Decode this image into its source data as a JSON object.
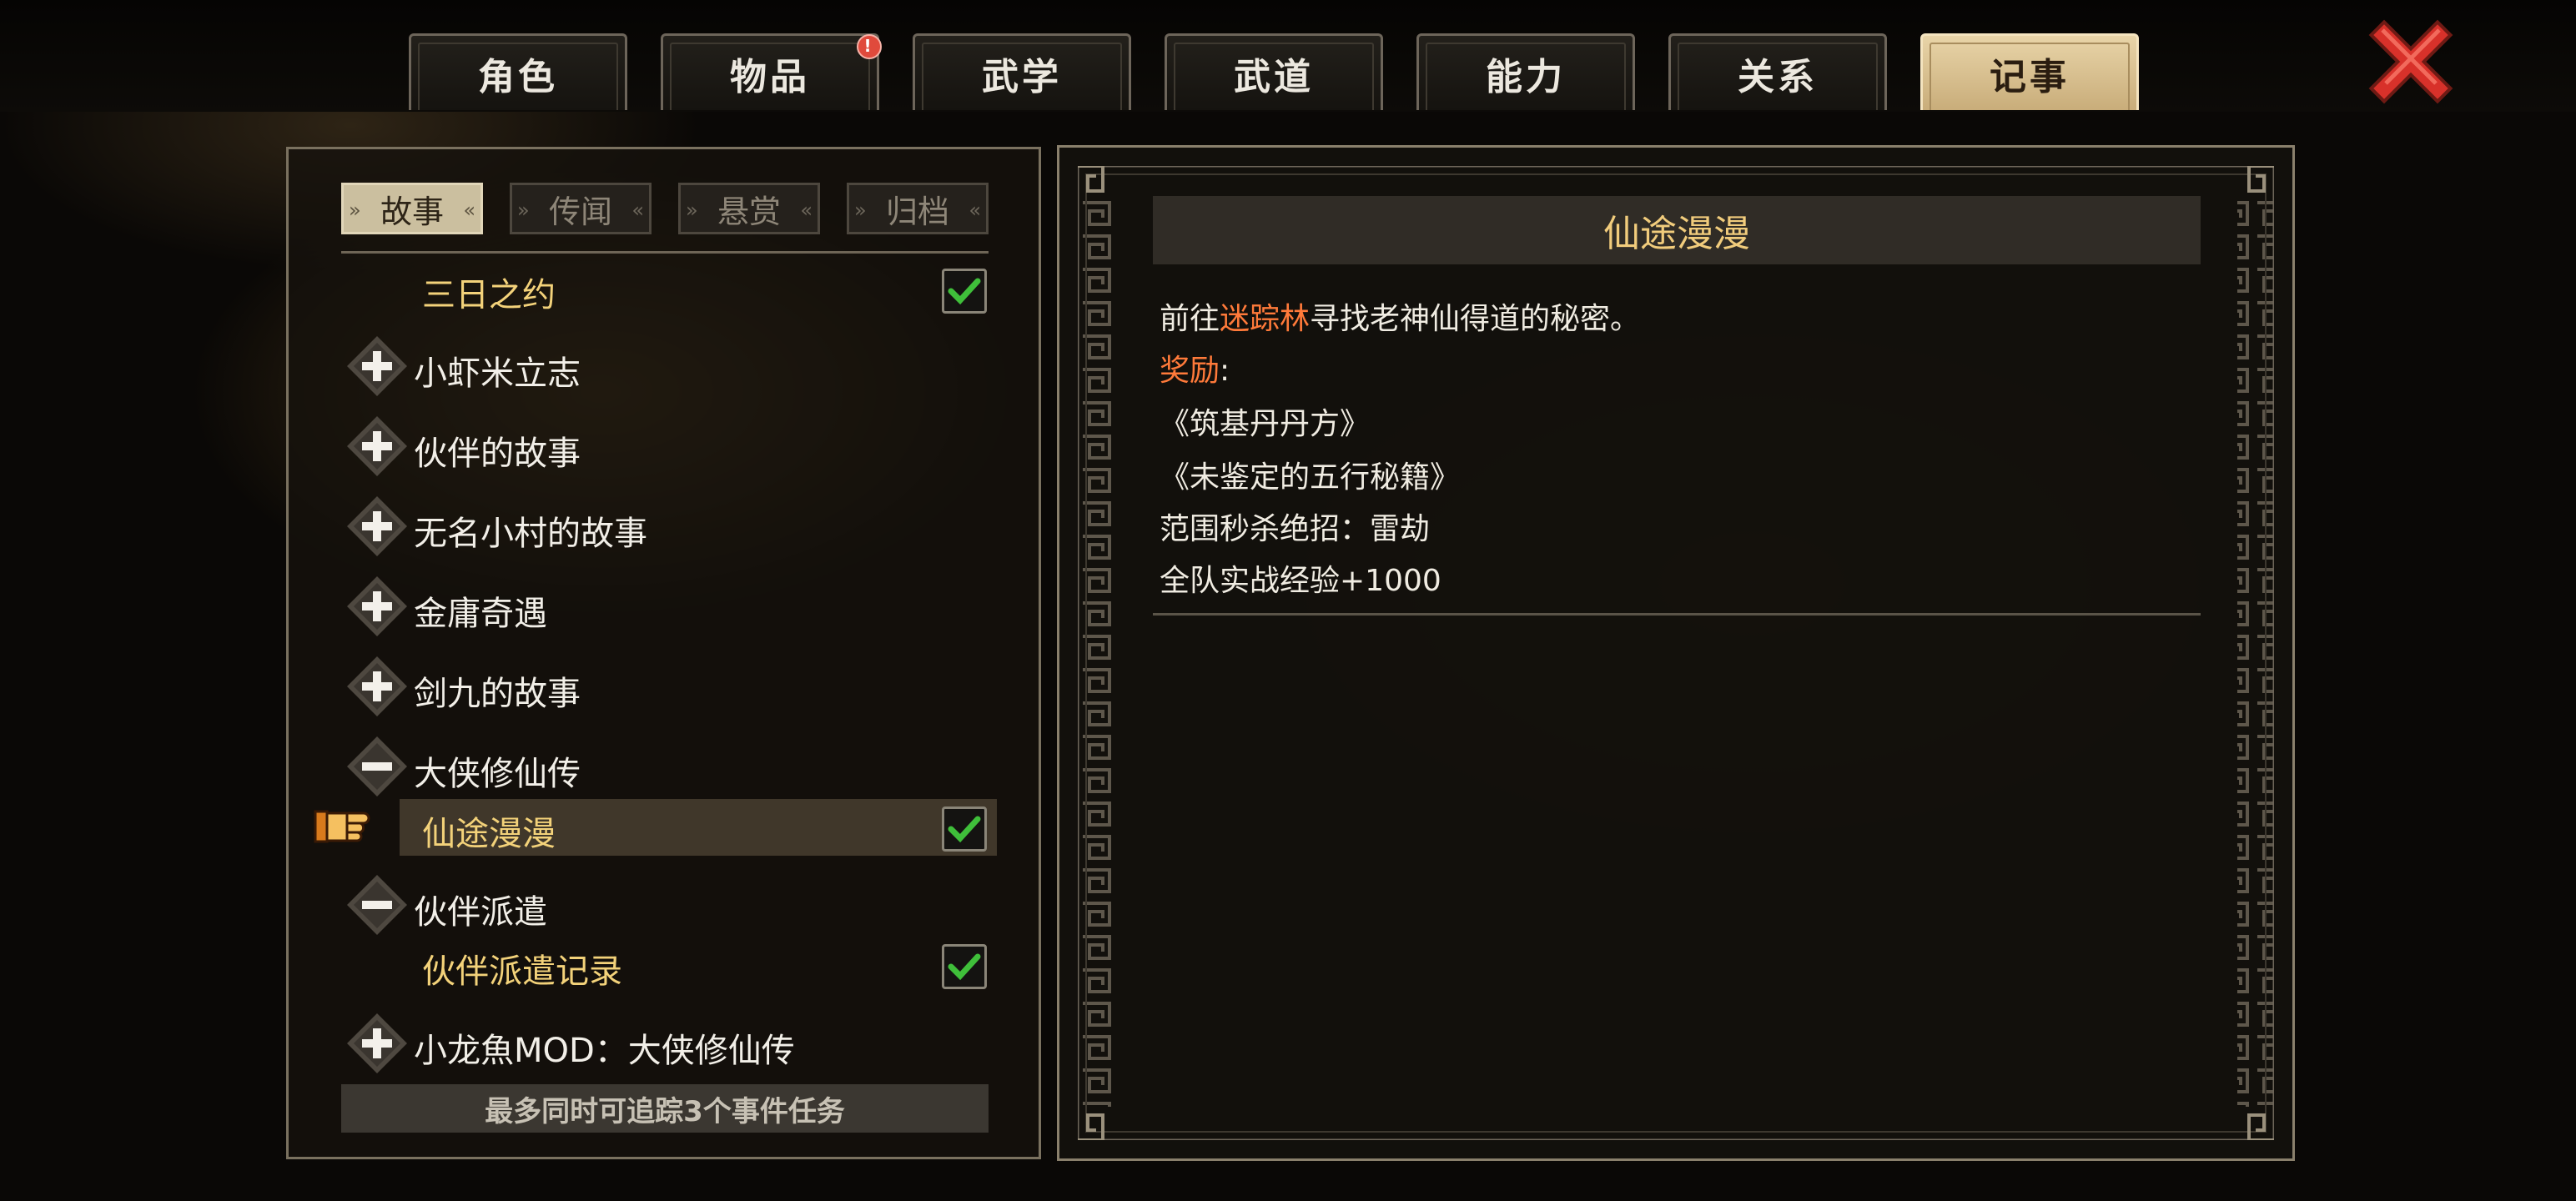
{
  "tabs": [
    {
      "label": "角色",
      "active": false,
      "badge": ""
    },
    {
      "label": "物品",
      "active": false,
      "badge": "!"
    },
    {
      "label": "武学",
      "active": false,
      "badge": ""
    },
    {
      "label": "武道",
      "active": false,
      "badge": ""
    },
    {
      "label": "能力",
      "active": false,
      "badge": ""
    },
    {
      "label": "关系",
      "active": false,
      "badge": ""
    },
    {
      "label": "记事",
      "active": true,
      "badge": ""
    }
  ],
  "subtabs": [
    {
      "label": "故事",
      "active": true
    },
    {
      "label": "传闻",
      "active": false
    },
    {
      "label": "悬赏",
      "active": false
    },
    {
      "label": "归档",
      "active": false
    }
  ],
  "list": [
    {
      "type": "quest",
      "label": "三日之约",
      "checked": true
    },
    {
      "type": "group",
      "label": "小虾米立志",
      "expanded": false
    },
    {
      "type": "group",
      "label": "伙伴的故事",
      "expanded": false
    },
    {
      "type": "group",
      "label": "无名小村的故事",
      "expanded": false
    },
    {
      "type": "group",
      "label": "金庸奇遇",
      "expanded": false
    },
    {
      "type": "group",
      "label": "剑九的故事",
      "expanded": false
    },
    {
      "type": "group",
      "label": "大侠修仙传",
      "expanded": true
    },
    {
      "type": "quest",
      "label": "仙途漫漫",
      "checked": true,
      "selected": true
    },
    {
      "type": "group",
      "label": "伙伴派遣",
      "expanded": true
    },
    {
      "type": "quest",
      "label": "伙伴派遣记录",
      "checked": true
    },
    {
      "type": "group",
      "label": "小龙魚MOD：大侠修仙传",
      "expanded": false
    }
  ],
  "footer_text": "最多同时可追踪3个事件任务",
  "detail": {
    "title": "仙途漫漫",
    "desc_prefix": "前往",
    "desc_place": "迷踪林",
    "desc_suffix": "寻找老神仙得道的秘密。",
    "reward_label": "奖励",
    "reward_colon": ":",
    "rewards": [
      "《筑基丹丹方》",
      "《未鉴定的五行秘籍》",
      "范围秒杀绝招：雷劫",
      "全队实战经验+1000"
    ]
  },
  "colors": {
    "quest_text": "#f3d27a",
    "highlight": "#ff7a3a",
    "active_tab": "#d9c08e",
    "check_green": "#3fbf3a",
    "close_red": "#d8312a"
  },
  "icons": {
    "close": "close-x-icon",
    "expand": "plus-icon",
    "collapse": "minus-icon",
    "check": "checkmark-icon",
    "pointer": "pointing-hand-icon"
  }
}
